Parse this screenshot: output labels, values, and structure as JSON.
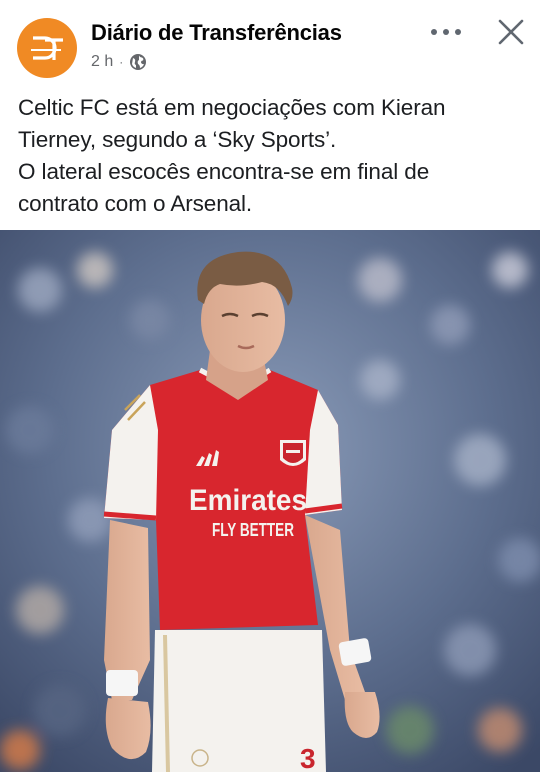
{
  "post": {
    "page_name": "Diário de Transferências",
    "time": "2 h",
    "dot": "·",
    "text_lines": [
      "Celtic FC está em negociações com Kieran",
      "Tierney, segundo a ‘Sky Sports’.",
      "O lateral escocês encontra-se em final de",
      "contrato com o Arsenal."
    ]
  },
  "image": {
    "sponsor_main": "Emirates",
    "sponsor_sub": "FLY BETTER",
    "shirt_number": "3"
  },
  "icons": {
    "avatar": "dt-logo-icon",
    "audience": "globe-icon",
    "more": "more-horizontal-icon",
    "close": "close-icon"
  },
  "colors": {
    "avatar_bg": "#f08a24",
    "jersey_red": "#d8262e",
    "meta_text": "#65676b"
  }
}
